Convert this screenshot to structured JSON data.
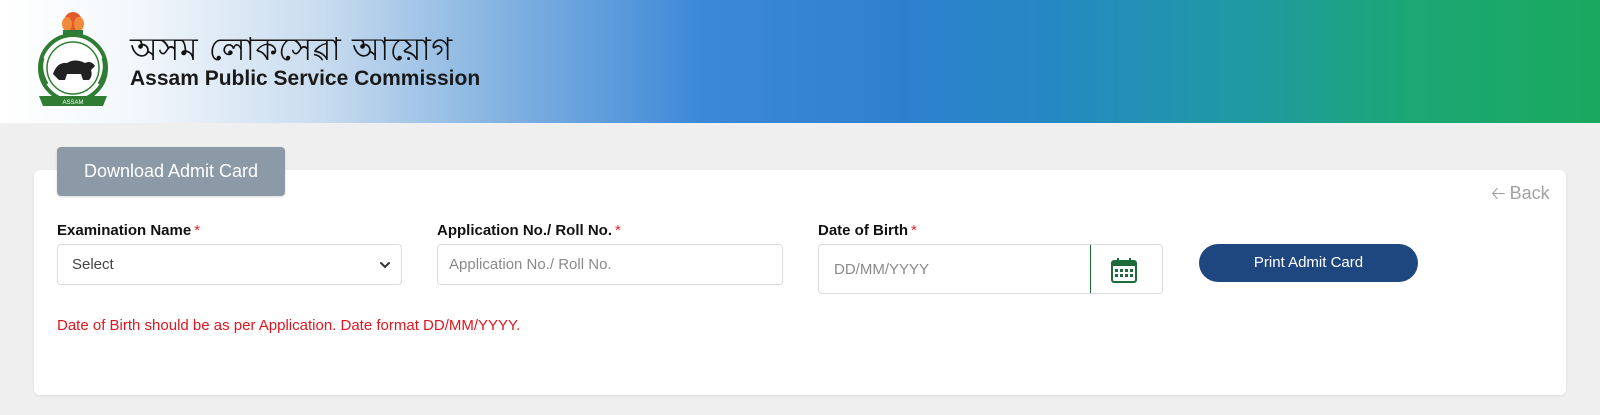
{
  "header": {
    "title_bn": "অসম লোকসেৱা আয়োগ",
    "title_en": "Assam Public Service Commission",
    "emblem_text": "ASSAM"
  },
  "tab": {
    "label": "Download Admit Card"
  },
  "back": {
    "label": "Back"
  },
  "form": {
    "exam": {
      "label": "Examination Name",
      "value": "Select"
    },
    "application": {
      "label": "Application No./ Roll No.",
      "placeholder": "Application No./ Roll No."
    },
    "dob": {
      "label": "Date of Birth",
      "placeholder": "DD/MM/YYYY"
    },
    "required_mark": "*",
    "print_button": "Print Admit Card",
    "note": "Date of Birth should be as per Application. Date format DD/MM/YYYY."
  },
  "colors": {
    "button_bg": "#1f477f",
    "tab_bg": "#8b9aa6",
    "error_text": "#e0161e",
    "calendar_icon": "#1e6a3b"
  },
  "icons": {
    "back": "arrow-left-icon",
    "dropdown": "chevron-down-icon",
    "calendar": "calendar-icon"
  }
}
